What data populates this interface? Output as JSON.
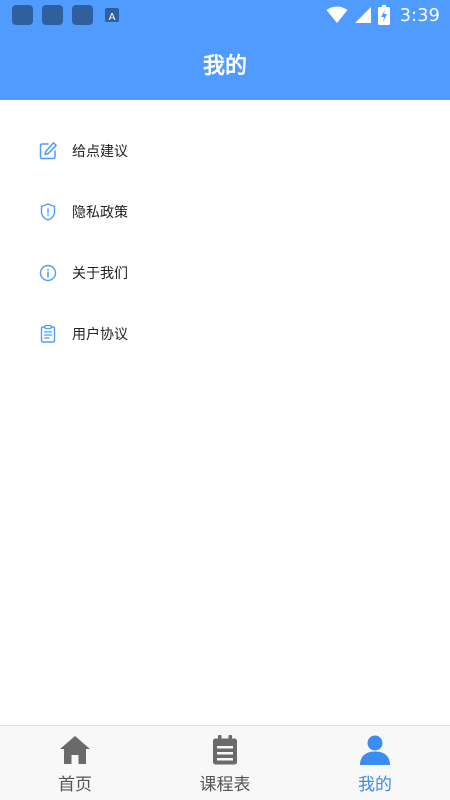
{
  "status_bar": {
    "time": "3:39",
    "notification_icon_glyph": "A"
  },
  "header": {
    "title": "我的"
  },
  "menu": [
    {
      "label": "给点建议",
      "icon": "edit-icon"
    },
    {
      "label": "隐私政策",
      "icon": "shield-icon"
    },
    {
      "label": "关于我们",
      "icon": "info-icon"
    },
    {
      "label": "用户协议",
      "icon": "clipboard-icon"
    }
  ],
  "bottom_nav": [
    {
      "label": "首页",
      "icon": "home-icon",
      "active": false
    },
    {
      "label": "课程表",
      "icon": "calendar-icon",
      "active": false
    },
    {
      "label": "我的",
      "icon": "user-icon",
      "active": true
    }
  ],
  "colors": {
    "accent": "#4f9bff",
    "active_tab": "#3a8cf0",
    "inactive_tab": "#555555"
  }
}
